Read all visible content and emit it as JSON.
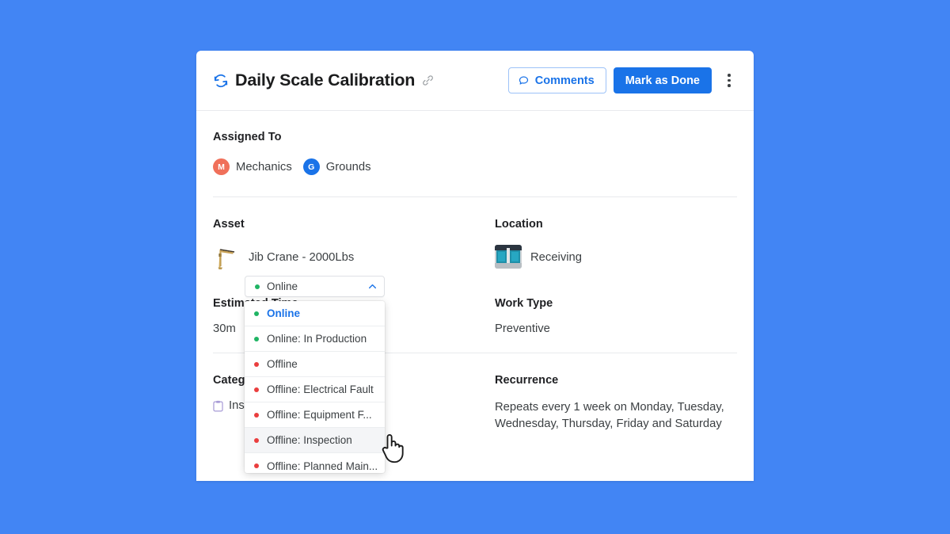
{
  "theme": {
    "page_background": "#4285f4",
    "accent": "#1a73e8",
    "card_background": "#ffffff",
    "online_dot": "#20b464",
    "offline_dot": "#ea3e3e",
    "avatar_mechanics": "#f0705a",
    "avatar_grounds": "#1a73e8",
    "category_icon": "#a79bd6"
  },
  "header": {
    "recurring_icon": "refresh-cw-icon",
    "title": "Daily Scale Calibration",
    "link_icon": "link-icon",
    "comments_icon": "comment-bubble-icon",
    "comments_label": "Comments",
    "mark_done_label": "Mark as Done",
    "more_icon": "kebab-menu-icon"
  },
  "assigned": {
    "label": "Assigned To",
    "people": [
      {
        "initial": "M",
        "name": "Mechanics",
        "color": "#f0705a"
      },
      {
        "initial": "G",
        "name": "Grounds",
        "color": "#1a73e8"
      }
    ]
  },
  "asset": {
    "label": "Asset",
    "name": "Jib Crane - 2000Lbs",
    "thumbnail": "jib-crane-photo"
  },
  "location": {
    "label": "Location",
    "name": "Receiving",
    "thumbnail": "loading-dock-photo"
  },
  "status_dropdown": {
    "selected": "Online",
    "selected_dot": "#20b464",
    "chevron_icon": "chevron-up-icon",
    "expanded": true,
    "options": [
      {
        "label": "Online",
        "dot": "#20b464",
        "selected": true,
        "hovered": false
      },
      {
        "label": "Online: In Production",
        "dot": "#20b464",
        "selected": false,
        "hovered": false
      },
      {
        "label": "Offline",
        "dot": "#ea3e3e",
        "selected": false,
        "hovered": false
      },
      {
        "label": "Offline: Electrical Fault",
        "dot": "#ea3e3e",
        "selected": false,
        "hovered": false
      },
      {
        "label": "Offline: Equipment F...",
        "dot": "#ea3e3e",
        "selected": false,
        "hovered": false
      },
      {
        "label": "Offline: Inspection",
        "dot": "#ea3e3e",
        "selected": false,
        "hovered": true
      },
      {
        "label": "Offline: Planned Main...",
        "dot": "#ea3e3e",
        "selected": false,
        "hovered": false
      }
    ]
  },
  "estimated_time": {
    "label": "Estimated Time",
    "value": "30m"
  },
  "work_type": {
    "label": "Work Type",
    "value": "Preventive"
  },
  "category": {
    "label": "Category",
    "icon": "clipboard-icon",
    "value": "Inspection"
  },
  "recurrence": {
    "label": "Recurrence",
    "value": "Repeats every 1 week on Monday, Tuesday, Wednesday, Thursday, Friday and Saturday"
  },
  "cursor": {
    "icon": "pointing-hand-cursor"
  }
}
